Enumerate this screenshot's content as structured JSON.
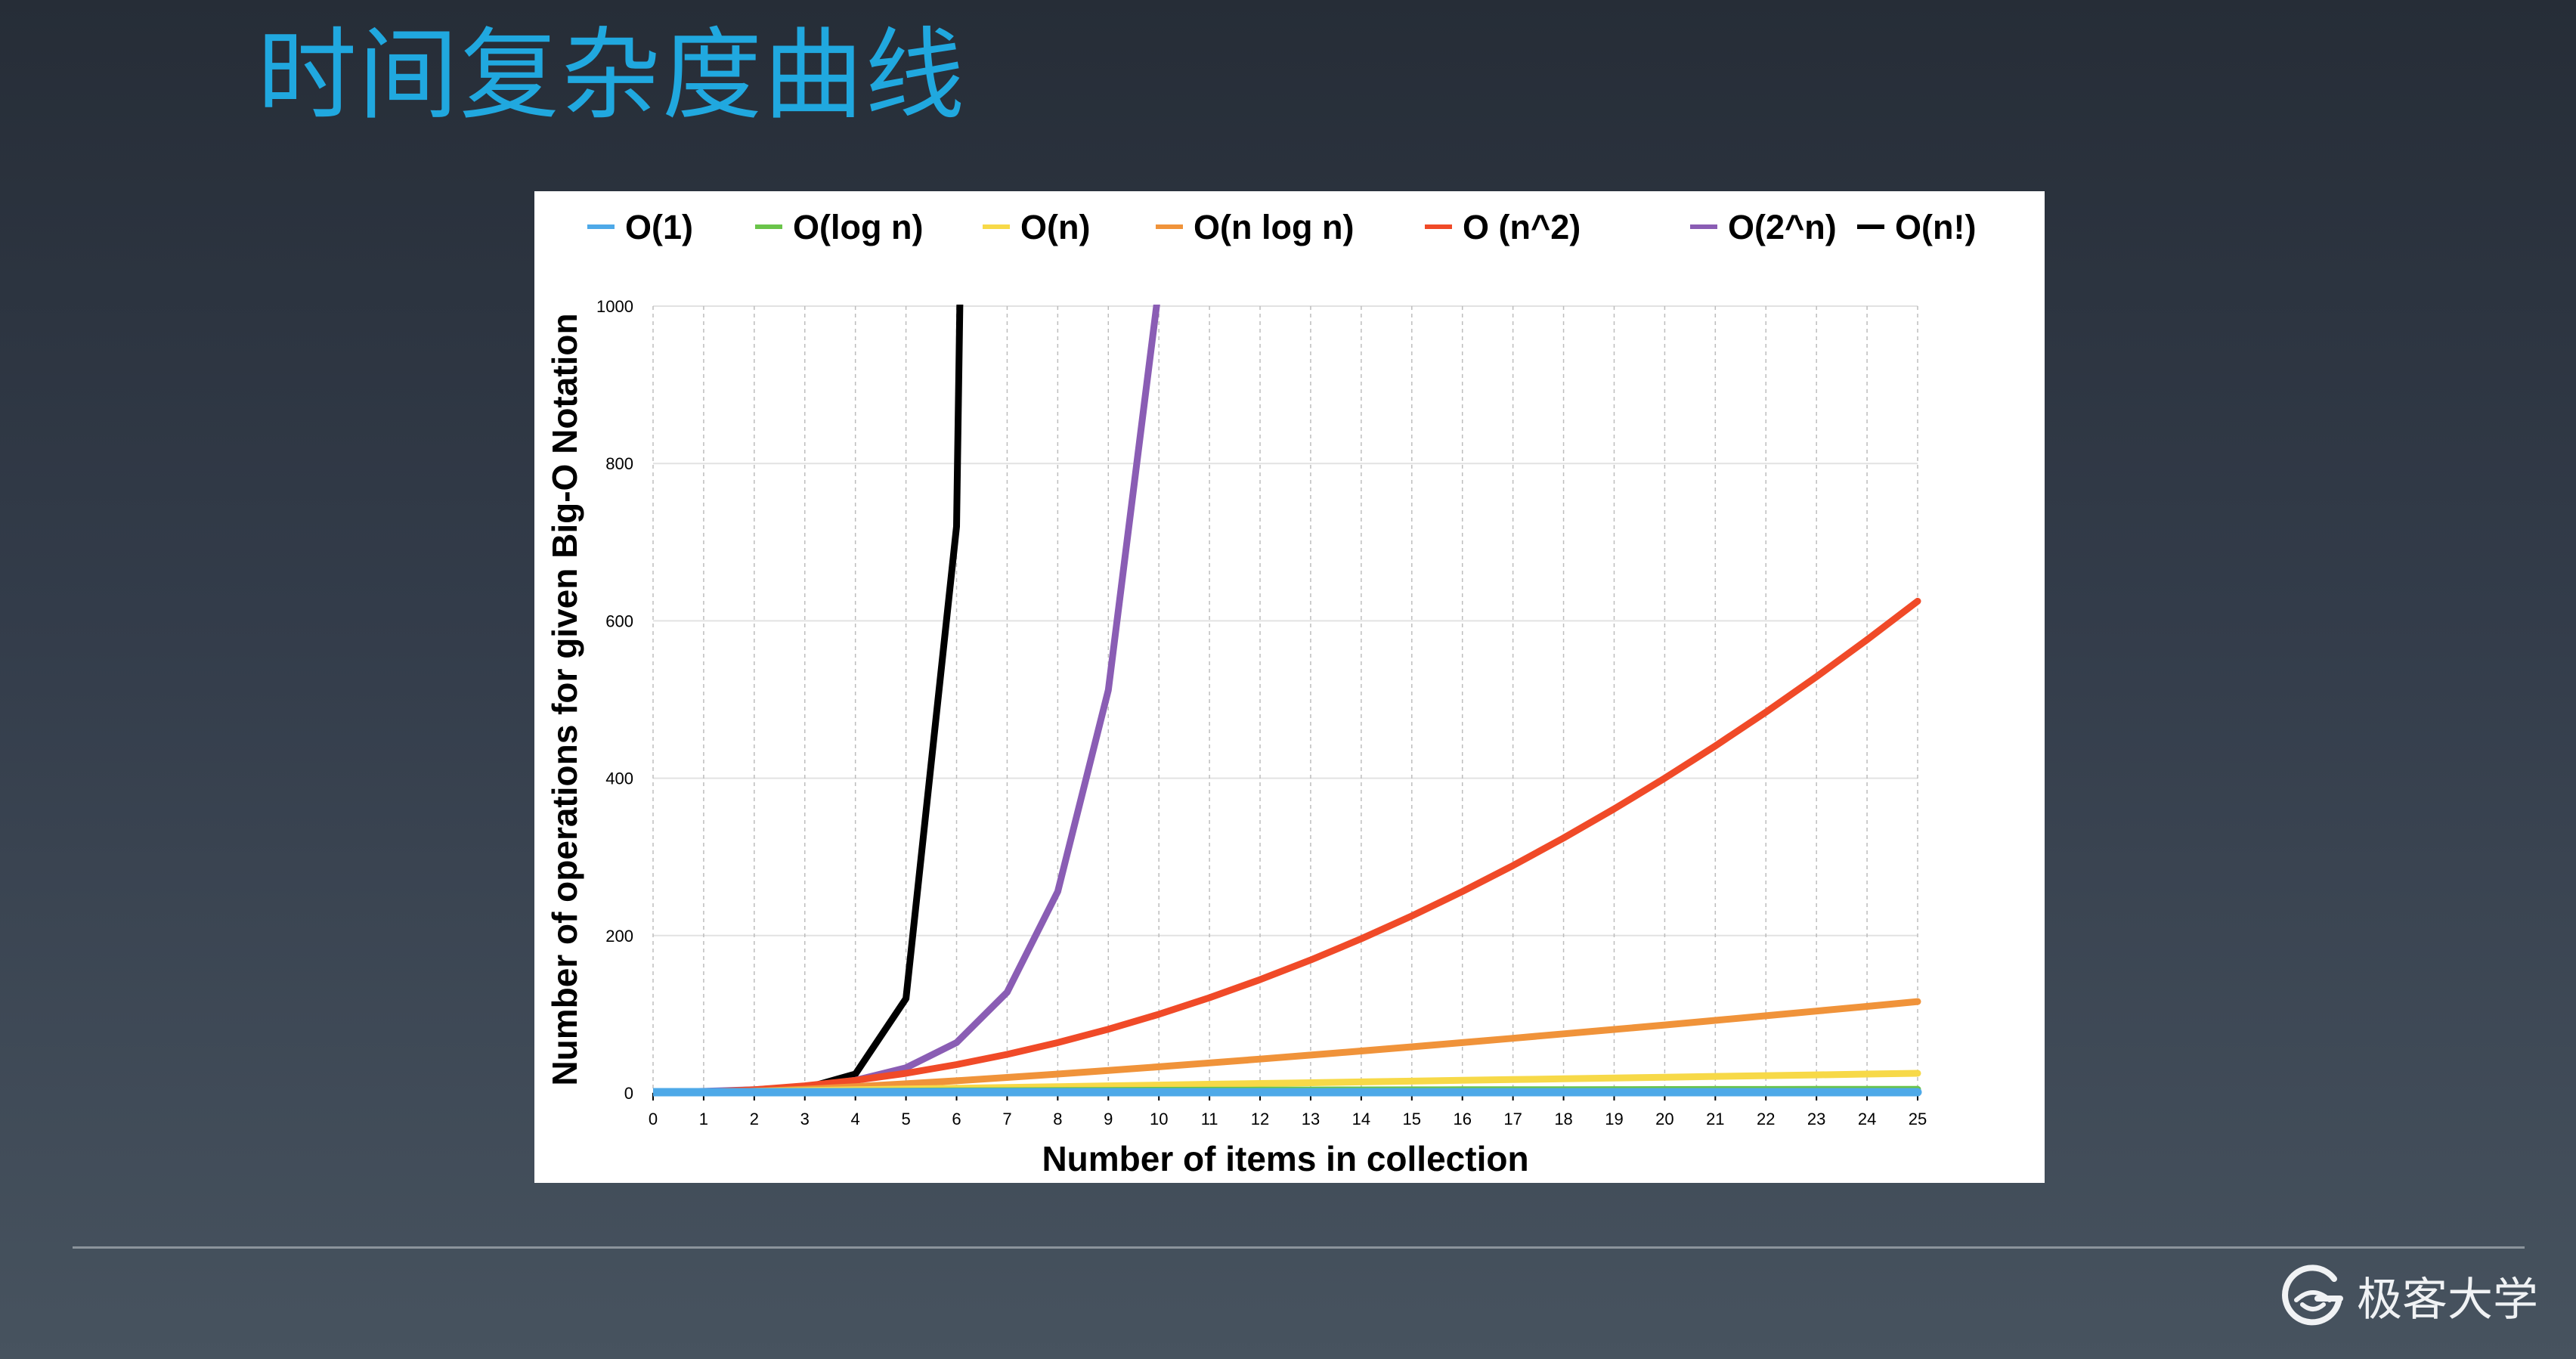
{
  "slide": {
    "title": "时间复杂度曲线",
    "logo_text": "极客大学"
  },
  "colors": {
    "title": "#20a8df",
    "background_top": "#262d37",
    "background_bottom": "#47535f"
  },
  "chart_data": {
    "type": "line",
    "title": "",
    "xlabel": "Number of items in collection",
    "ylabel": "Number of operations for given Big-O Notation",
    "x": [
      0,
      1,
      2,
      3,
      4,
      5,
      6,
      7,
      8,
      9,
      10,
      11,
      12,
      13,
      14,
      15,
      16,
      17,
      18,
      19,
      20,
      21,
      22,
      23,
      24,
      25
    ],
    "xlim": [
      0,
      25
    ],
    "ylim": [
      0,
      1000
    ],
    "x_ticks": [
      0,
      1,
      2,
      3,
      4,
      5,
      6,
      7,
      8,
      9,
      10,
      11,
      12,
      13,
      14,
      15,
      16,
      17,
      18,
      19,
      20,
      21,
      22,
      23,
      24,
      25
    ],
    "y_ticks": [
      0,
      200,
      400,
      600,
      800,
      1000
    ],
    "grid": true,
    "legend_position": "top",
    "series": [
      {
        "name": "O(1)",
        "color": "#4ea9e8",
        "values": [
          1,
          1,
          1,
          1,
          1,
          1,
          1,
          1,
          1,
          1,
          1,
          1,
          1,
          1,
          1,
          1,
          1,
          1,
          1,
          1,
          1,
          1,
          1,
          1,
          1,
          1
        ]
      },
      {
        "name": "O(log n)",
        "color": "#6ac44a",
        "values": [
          0,
          0,
          1,
          1.58,
          2,
          2.32,
          2.58,
          2.81,
          3,
          3.17,
          3.32,
          3.46,
          3.58,
          3.7,
          3.81,
          3.91,
          4,
          4.09,
          4.17,
          4.25,
          4.32,
          4.39,
          4.46,
          4.52,
          4.58,
          4.64
        ]
      },
      {
        "name": "O(n)",
        "color": "#f7d948",
        "values": [
          0,
          1,
          2,
          3,
          4,
          5,
          6,
          7,
          8,
          9,
          10,
          11,
          12,
          13,
          14,
          15,
          16,
          17,
          18,
          19,
          20,
          21,
          22,
          23,
          24,
          25
        ]
      },
      {
        "name": "O(n log n)",
        "color": "#f0933a",
        "values": [
          0,
          0,
          2,
          4.75,
          8,
          11.6,
          15.5,
          19.7,
          24,
          28.5,
          33.2,
          38.1,
          43,
          48.1,
          53.3,
          58.6,
          64,
          69.5,
          75.1,
          80.7,
          86.4,
          92.2,
          98.1,
          104,
          110,
          116.1
        ]
      },
      {
        "name": "O (n^2)",
        "color": "#f04a28",
        "values": [
          0,
          1,
          4,
          9,
          16,
          25,
          36,
          49,
          64,
          81,
          100,
          121,
          144,
          169,
          196,
          225,
          256,
          289,
          324,
          361,
          400,
          441,
          484,
          529,
          576,
          625
        ]
      },
      {
        "name": "O(2^n)",
        "color": "#8a5db4",
        "values": [
          1,
          2,
          4,
          8,
          16,
          32,
          64,
          128,
          256,
          512,
          1024,
          2048,
          4096,
          8192,
          16384,
          32768,
          65536,
          131072,
          262144,
          524288,
          1048576,
          2097152,
          4194304,
          8388608,
          16777216,
          33554432
        ]
      },
      {
        "name": "O(n!)",
        "color": "#000000",
        "values": [
          1,
          1,
          2,
          6,
          24,
          120,
          720,
          5040,
          40320,
          362880,
          3628800,
          39916800,
          479001600,
          6227020800,
          87178291200,
          1307674368000,
          20922789888000,
          355687428096000,
          6402373705728000,
          1.21645100408832e+17,
          2.43290200817664e+18,
          5.109094217170944e+19,
          1.1240007277776077e+21,
          2.585201673888498e+22,
          6.204484017332394e+23,
          1.5511210043330986e+25
        ]
      }
    ]
  }
}
